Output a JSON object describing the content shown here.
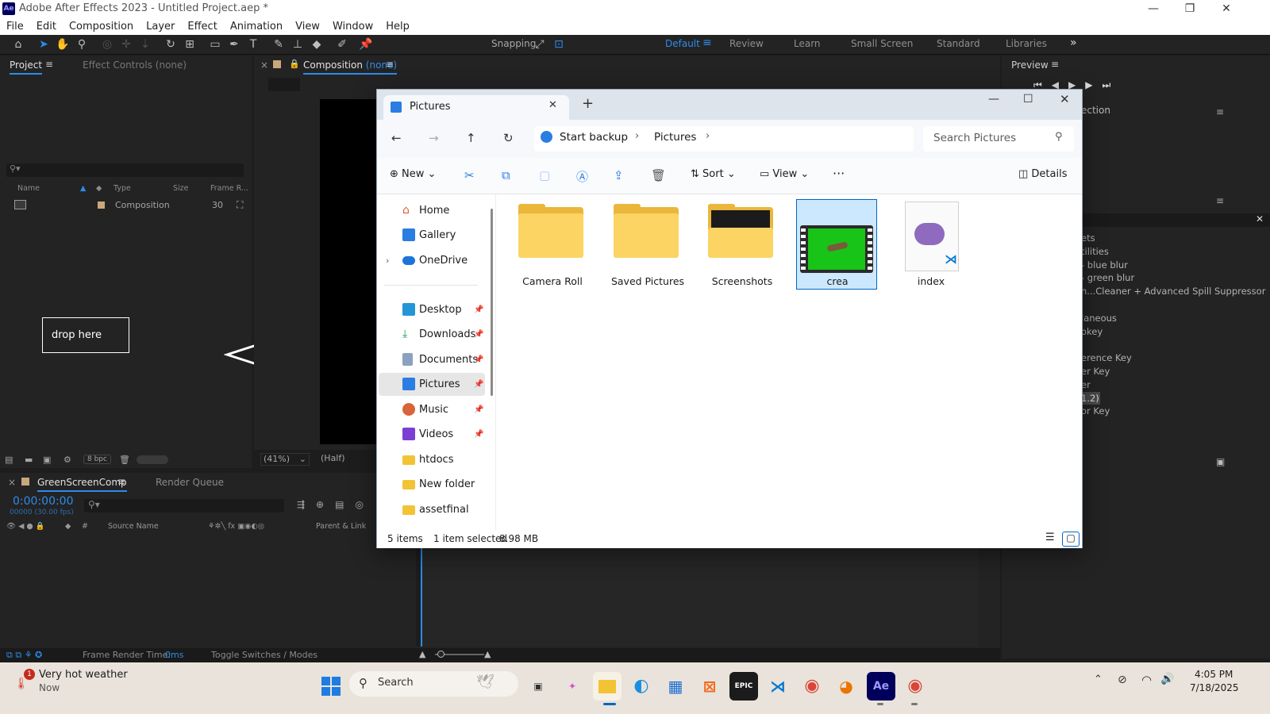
{
  "app": {
    "logo": "Ae",
    "title": "Adobe After Effects 2023 - Untitled Project.aep *"
  },
  "menu": [
    "File",
    "Edit",
    "Composition",
    "Layer",
    "Effect",
    "Animation",
    "View",
    "Window",
    "Help"
  ],
  "toolbar": {
    "snapping_label": "Snapping",
    "workspaces": [
      "Default",
      "Review",
      "Learn",
      "Small Screen",
      "Standard",
      "Libraries"
    ],
    "active_workspace": "Default",
    "more": "»"
  },
  "project_panel": {
    "tab_project": "Project",
    "tab_effect_controls": "Effect Controls (none)",
    "columns": [
      "Name",
      "Type",
      "Size",
      "Frame R..."
    ],
    "rows": [
      {
        "type": "Composition",
        "frame_rate": "30"
      }
    ],
    "drop_box_label": "drop here",
    "bpc": "8 bpc"
  },
  "comp_panel": {
    "tab_label": "Composition",
    "tab_value": "(none)",
    "zoom": "(41%)",
    "resolution": "(Half)"
  },
  "preview_panel": {
    "tab_label": "Preview",
    "partial_tab": "ection",
    "effects_list": [
      "ets",
      "tilities",
      "- blue blur",
      "- green blur",
      "h...Cleaner + Advanced Spill Suppressor",
      "",
      "laneous",
      "okey",
      "",
      "erence Key",
      "er Key",
      "er",
      "1.2)",
      "or Key"
    ]
  },
  "timeline": {
    "comp_tab": "GreenScreenComp",
    "render_queue_tab": "Render Queue",
    "timecode": "0:00:00:00",
    "frame_info": "00000 (30.00 fps)",
    "col_source_name": "Source Name",
    "col_parent": "Parent & Link",
    "col_hash": "#"
  },
  "statusbar": {
    "frame_render_label": "Frame Render Time:",
    "frame_render_value": "0ms",
    "toggle_label": "Toggle Switches / Modes"
  },
  "explorer": {
    "tab_title": "Pictures",
    "breadcrumb": [
      "Start backup",
      "Pictures"
    ],
    "search_placeholder": "Search Pictures",
    "cmd": {
      "new": "New",
      "sort": "Sort",
      "view": "View",
      "details": "Details"
    },
    "nav": [
      {
        "label": "Home",
        "icon": "home-icon"
      },
      {
        "label": "Gallery",
        "icon": "gallery-icon"
      },
      {
        "label": "OneDrive",
        "icon": "cloud-icon"
      },
      {
        "label": "Desktop",
        "icon": "desktop-icon"
      },
      {
        "label": "Downloads",
        "icon": "download-icon"
      },
      {
        "label": "Documents",
        "icon": "document-icon"
      },
      {
        "label": "Pictures",
        "icon": "pictures-icon"
      },
      {
        "label": "Music",
        "icon": "music-icon"
      },
      {
        "label": "Videos",
        "icon": "video-icon"
      },
      {
        "label": "htdocs",
        "icon": "folder-icon"
      },
      {
        "label": "New folder",
        "icon": "folder-icon"
      },
      {
        "label": "assetfinal",
        "icon": "folder-icon"
      }
    ],
    "files": [
      {
        "name": "Camera Roll",
        "kind": "folder"
      },
      {
        "name": "Saved Pictures",
        "kind": "folder"
      },
      {
        "name": "Screenshots",
        "kind": "folder"
      },
      {
        "name": "crea",
        "kind": "video"
      },
      {
        "name": "index",
        "kind": "php"
      }
    ],
    "status": {
      "items": "5 items",
      "selected": "1 item selected",
      "size": "8.98 MB"
    }
  },
  "taskbar": {
    "weather_title": "Very hot weather",
    "weather_sub": "Now",
    "weather_badge": "1",
    "search_label": "Search",
    "time": "4:05 PM",
    "date": "7/18/2025",
    "apps": [
      "windows-start",
      "task-view",
      "copilot",
      "file-explorer",
      "edge",
      "microsoft-store",
      "xampp",
      "epic-games",
      "vs-code",
      "chrome",
      "blender",
      "after-effects",
      "chrome-profile"
    ]
  },
  "colors": {
    "accent": "#2d8ceb",
    "ae_bg": "#1d1d1d",
    "explorer_selected": "#cce8ff",
    "folder_yellow": "#fbd463",
    "green_screen": "#18c418"
  }
}
